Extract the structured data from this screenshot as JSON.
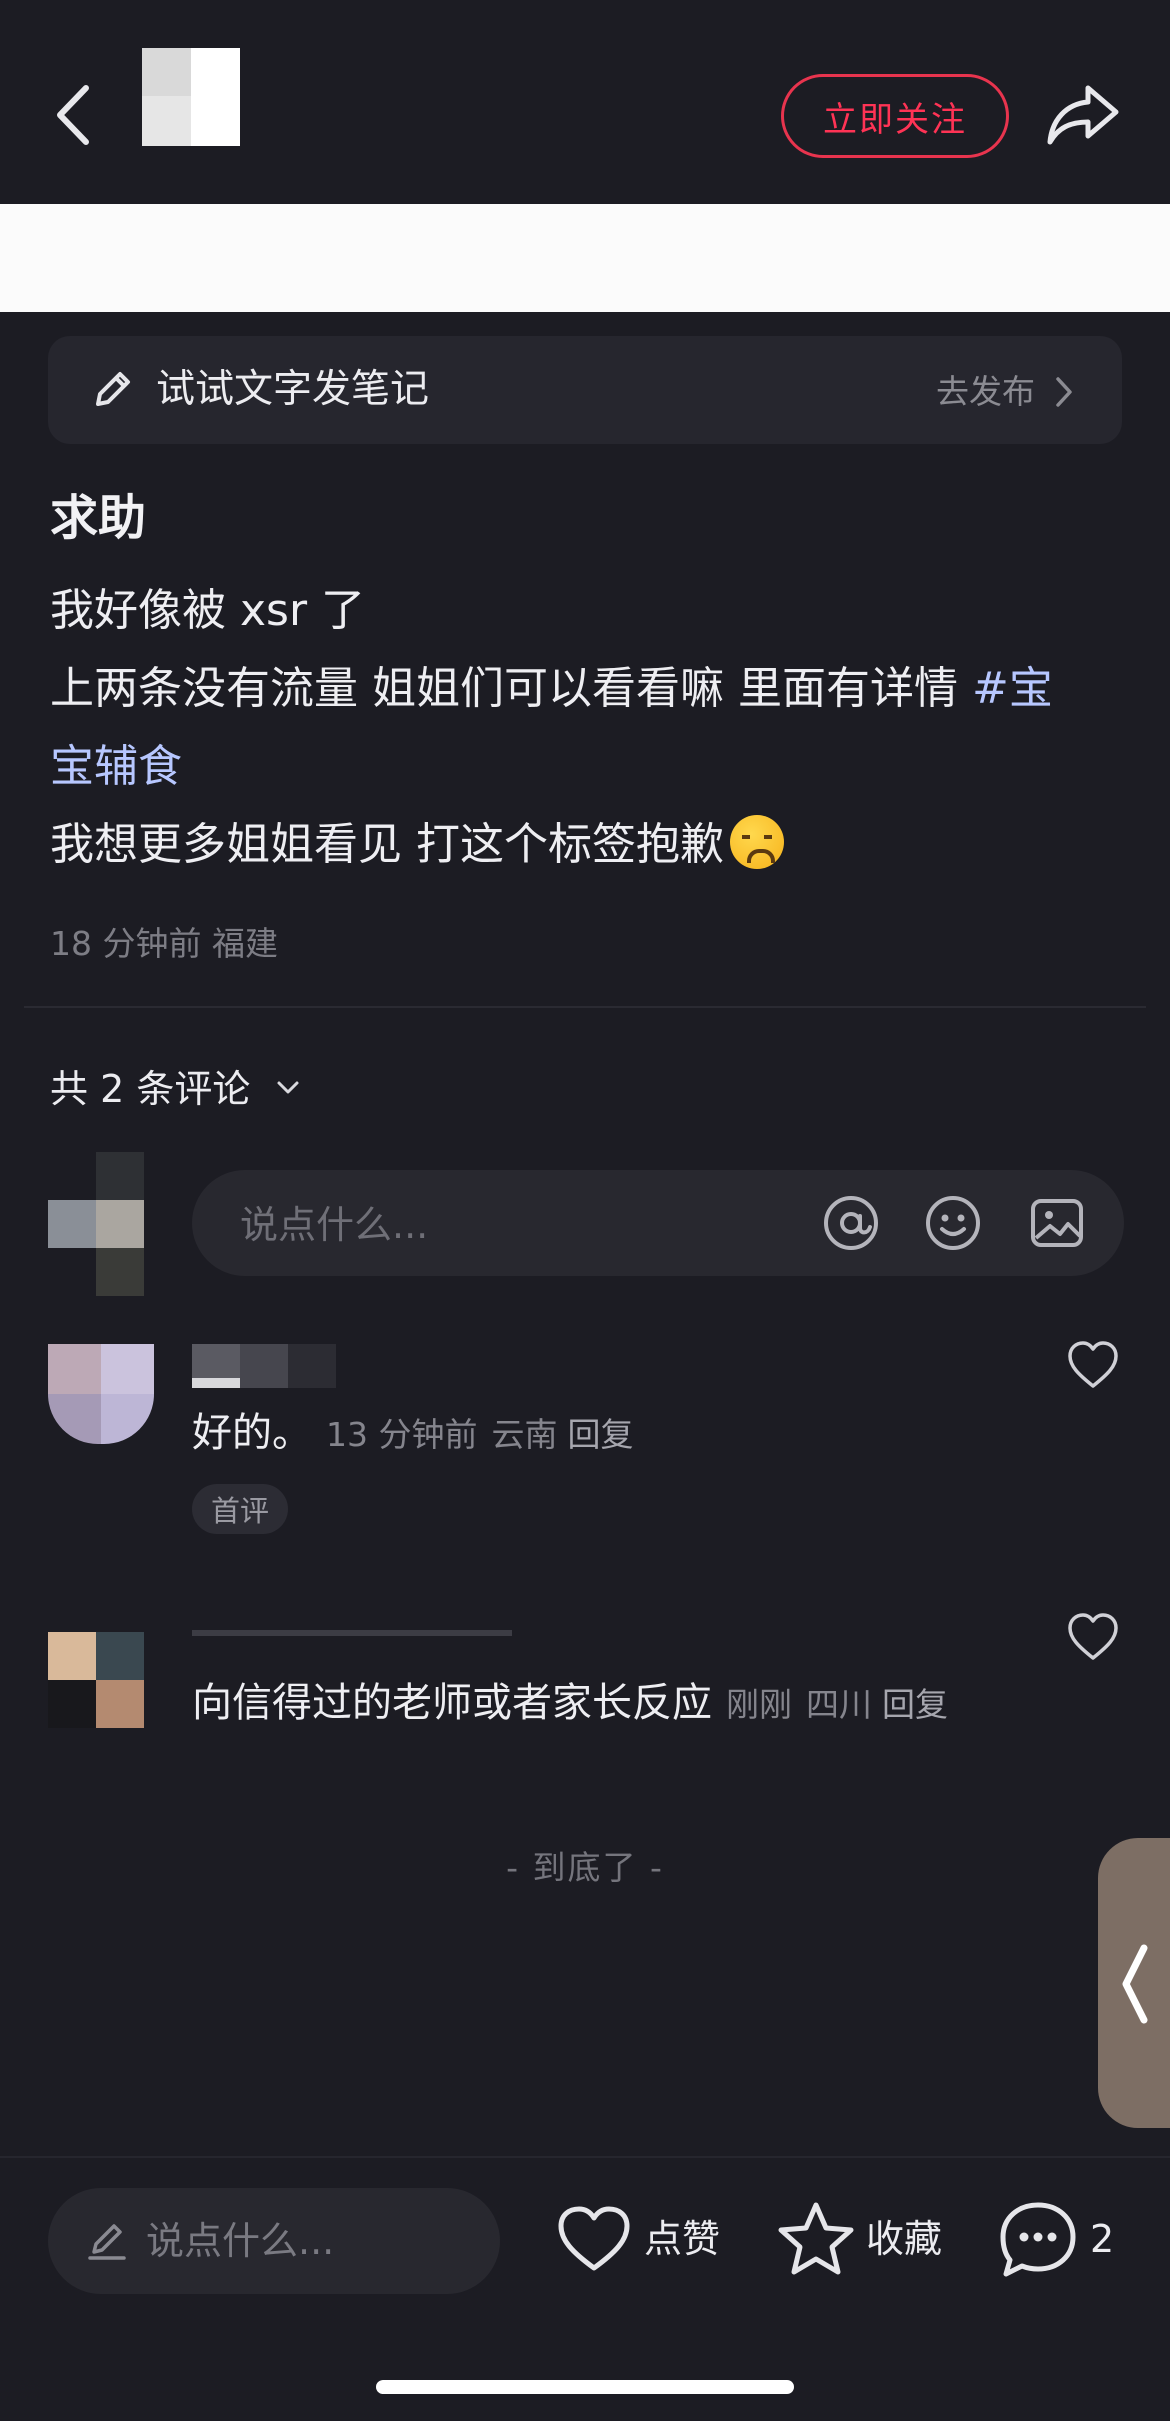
{
  "colors": {
    "background": "#1c1c23",
    "follow_accent": "#ff3355",
    "hashtag": "#b7c7ff",
    "muted_text": "#7d7d85"
  },
  "header": {
    "back_icon": "chevron-left-icon",
    "follow_label": "立即关注",
    "share_icon": "share-arrow-icon"
  },
  "try_banner": {
    "icon": "pencil-icon",
    "text": "试试文字发笔记",
    "action": "去发布"
  },
  "post": {
    "title": "求助",
    "line1": "我好像被 xsr 了",
    "line2_text": "上两条没有流量 姐姐们可以看看嘛 里面有详情 ",
    "line2_hashtag_a": "#宝",
    "line3_hashtag_b": "宝辅食",
    "line4_text": "我想更多姐姐看见 打这个标签抱歉",
    "line4_emoji": "disappointed-face-emoji",
    "time": "18 分钟前",
    "location": "福建"
  },
  "comments_section": {
    "count_label": "共 2 条评论",
    "input_placeholder": "说点什么...",
    "comments": [
      {
        "text": "好的。",
        "time": "13 分钟前",
        "location": "云南",
        "reply_label": "回复",
        "tag": "首评"
      },
      {
        "text": "向信得过的老师或者家长反应",
        "time": "刚刚",
        "location": "四川",
        "reply_label": "回复"
      }
    ],
    "end_label": "- 到底了 -"
  },
  "bottom_bar": {
    "input_placeholder": "说点什么...",
    "like_label": "点赞",
    "collect_label": "收藏",
    "comment_count": "2"
  }
}
